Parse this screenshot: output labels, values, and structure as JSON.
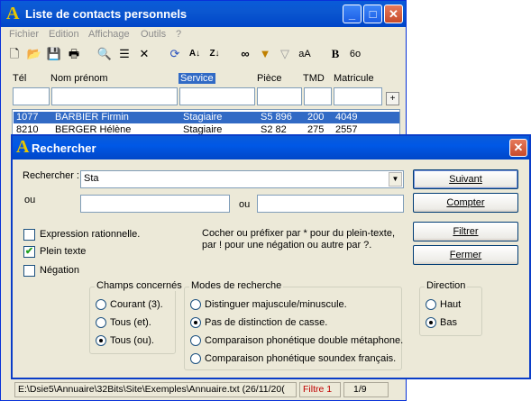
{
  "main_window": {
    "title": "Liste de contacts personnels",
    "menu": [
      "Fichier",
      "Edition",
      "Affichage",
      "Outils",
      "?"
    ],
    "toolbar_icons": [
      "new-icon",
      "open-icon",
      "save-icon",
      "print-icon",
      "zoom-icon",
      "list-icon",
      "delete-icon",
      "refresh-icon",
      "sort-asc-icon",
      "sort-desc-icon",
      "binoculars-icon",
      "filter-icon",
      "filter-off-icon",
      "case-icon",
      "bold-icon",
      "glasses-icon"
    ],
    "columns": [
      "Tél",
      "Nom prénom",
      "Service",
      "Pièce",
      "TMD",
      "Matricule"
    ],
    "selected_column": "Service",
    "add_button": "+",
    "rows": [
      {
        "tel": "1077",
        "nom": "BARBIER Firmin",
        "service": "Stagiaire",
        "piece": "S5 896",
        "tmd": "200",
        "matricule": "4049"
      },
      {
        "tel": "8210",
        "nom": "BERGER Hélène",
        "service": "Stagiaire",
        "piece": "S2 82",
        "tmd": "275",
        "matricule": "2557"
      }
    ],
    "status": {
      "path": "E:\\Dsie5\\Annuaire\\32Bits\\Site\\Exemples\\Annuaire.txt  (26/11/20(",
      "filter": "Filtre 1",
      "page": "1/9"
    }
  },
  "dialog": {
    "title": "Rechercher",
    "search_label": "Rechercher :",
    "search_value": "Sta",
    "ou_label_1": "ou",
    "ou_label_2": "ou",
    "or_field_1": "",
    "or_field_2": "",
    "buttons": {
      "next": "Suivant",
      "count": "Compter",
      "filter": "Filtrer",
      "close": "Fermer"
    },
    "checkboxes": [
      {
        "label": "Expression rationnelle.",
        "checked": false
      },
      {
        "label": "Plein texte",
        "checked": true
      },
      {
        "label": "Négation",
        "checked": false
      }
    ],
    "hint": "Cocher ou préfixer par * pour du plein-texte, par ! pour une négation ou autre par ?.",
    "fields_group": {
      "title": "Champs concernés",
      "options": [
        "Courant (3).",
        "Tous (et).",
        "Tous (ou)."
      ],
      "selected": 2
    },
    "modes_group": {
      "title": "Modes de recherche",
      "options": [
        "Distinguer majuscule/minuscule.",
        "Pas de distinction de casse.",
        "Comparaison phonétique double métaphone.",
        "Comparaison phonétique soundex français."
      ],
      "selected": 1
    },
    "direction_group": {
      "title": "Direction",
      "options": [
        "Haut",
        "Bas"
      ],
      "selected": 1
    }
  },
  "colors": {
    "titlebar": "#0058e6",
    "selection": "#316ac5",
    "window_bg": "#ece9d8",
    "filter_text": "#c00000"
  }
}
